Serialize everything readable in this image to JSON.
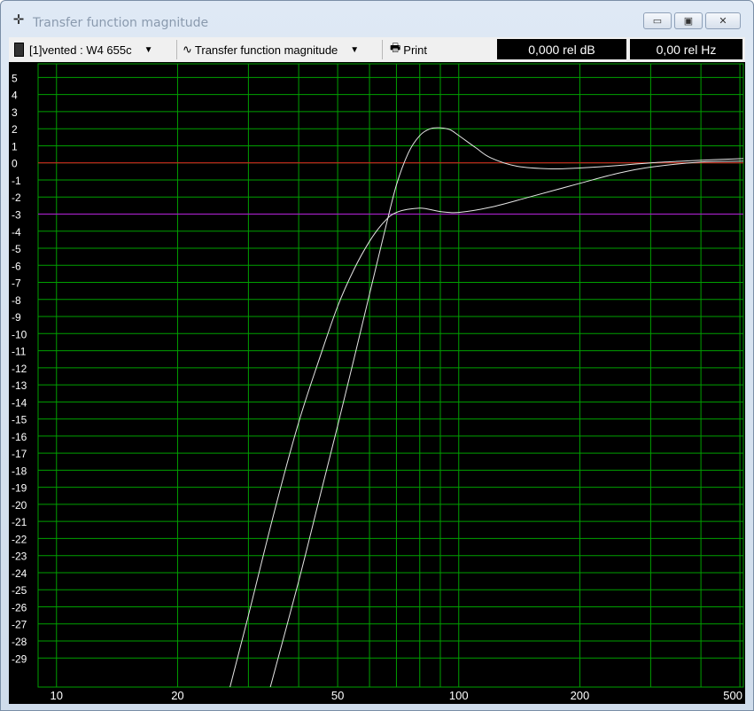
{
  "window": {
    "title": "Transfer function magnitude",
    "buttons": [
      "minimize",
      "maximize",
      "close"
    ]
  },
  "toolbar": {
    "driver_select": "[1]vented : W4 655c",
    "view_select": "Transfer function magnitude",
    "print_label": "Print",
    "readout_db": "0,000 rel dB",
    "readout_hz": "0,00 rel Hz"
  },
  "colors": {
    "background": "#000000",
    "grid": "#00a000",
    "curves": "#e6e6e6",
    "reference_line": "#d02020",
    "minus3_line": "#a020c0"
  },
  "chart_data": {
    "type": "line",
    "title": "Transfer function magnitude",
    "xlabel": "",
    "ylabel": "",
    "x_scale": "log",
    "xlim": [
      9,
      510
    ],
    "ylim": [
      -30.7,
      5.8
    ],
    "grid": true,
    "x_ticks": [
      10,
      20,
      50,
      100,
      200,
      500
    ],
    "y_ticks": [
      5,
      4,
      3,
      2,
      1,
      0,
      -1,
      -2,
      -3,
      -4,
      -5,
      -6,
      -7,
      -8,
      -9,
      -10,
      -11,
      -12,
      -13,
      -14,
      -15,
      -16,
      -17,
      -18,
      -19,
      -20,
      -21,
      -22,
      -23,
      -24,
      -25,
      -26,
      -27,
      -28,
      -29
    ],
    "reference_lines": [
      {
        "y": 0,
        "color": "#d02020"
      },
      {
        "y": -3,
        "color": "#a020c0"
      }
    ],
    "series": [
      {
        "x": [
          27,
          30,
          35,
          40,
          45,
          50,
          55,
          60,
          65,
          70,
          80,
          90,
          100,
          120,
          150,
          200,
          250,
          300,
          400,
          510
        ],
        "y": [
          -30.7,
          -26.5,
          -20.2,
          -15.2,
          -11.5,
          -8.4,
          -6.2,
          -4.6,
          -3.5,
          -2.9,
          -2.65,
          -2.85,
          -2.9,
          -2.6,
          -2.0,
          -1.2,
          -0.6,
          -0.25,
          0.05,
          0.1
        ]
      },
      {
        "x": [
          34,
          40,
          45,
          50,
          55,
          60,
          65,
          70,
          75,
          80,
          85,
          90,
          95,
          100,
          110,
          120,
          140,
          170,
          200,
          250,
          300,
          400,
          510
        ],
        "y": [
          -30.7,
          -24.5,
          -19.7,
          -15.4,
          -11.4,
          -7.7,
          -4.3,
          -1.3,
          0.6,
          1.6,
          2.0,
          2.05,
          1.95,
          1.6,
          0.9,
          0.3,
          -0.2,
          -0.35,
          -0.3,
          -0.15,
          0.0,
          0.15,
          0.25
        ]
      }
    ]
  }
}
